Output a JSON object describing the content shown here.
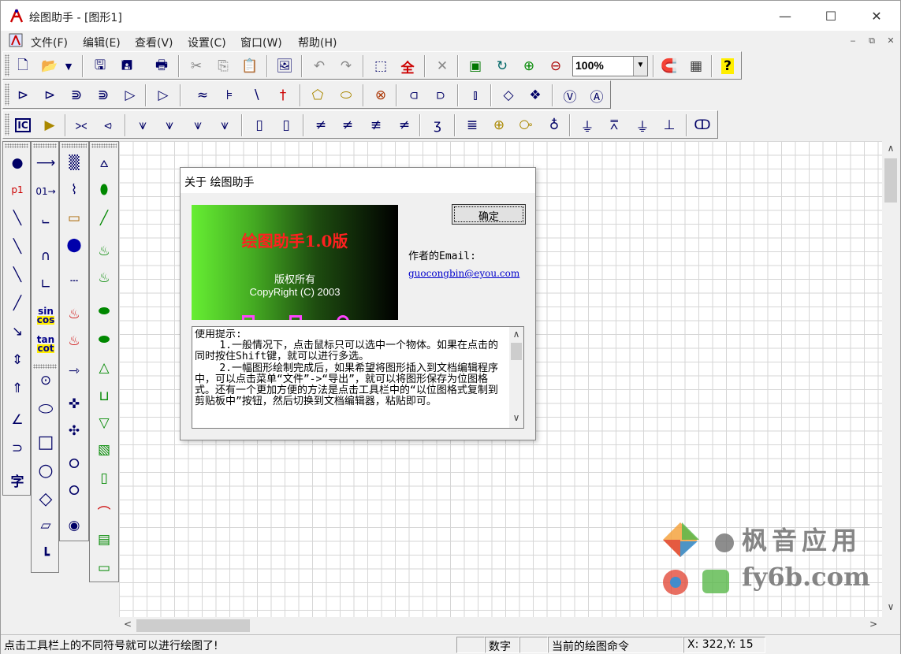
{
  "window": {
    "title": "绘图助手 - [图形1]"
  },
  "menu": {
    "items": [
      {
        "label": "文件(F)"
      },
      {
        "label": "编辑(E)"
      },
      {
        "label": "查看(V)"
      },
      {
        "label": "设置(C)"
      },
      {
        "label": "窗口(W)"
      },
      {
        "label": "帮助(H)"
      }
    ]
  },
  "toolbar": {
    "zoom_value": "100%"
  },
  "palette": {
    "p1_label": "p1",
    "sin_label": "sin",
    "cos_label": "cos",
    "tan_label": "tan",
    "cot_label": "cot",
    "text_label": "字"
  },
  "dialog": {
    "title": "关于 绘图助手",
    "splash_title": "绘图助手1.0版",
    "splash_rights": "版权所有",
    "splash_copyright": "CopyRight (C) 2003",
    "ok_label": "确定",
    "email_label": "作者的Email:",
    "email": "guocongbin@eyou.com",
    "tips": "使用提示:\n    1.一般情况下，点击鼠标只可以选中一个物体。如果在点击的同时按住Shift键，就可以进行多选。\n    2.一幅图形绘制完成后，如果希望将图形插入到文档编辑程序中，可以点击菜单“文件”->“导出”，就可以将图形保存为位图格式。还有一个更加方便的方法是点击工具栏中的“以位图格式复制到剪贴板中”按钮，然后切换到文档编辑器，粘贴即可。"
  },
  "status": {
    "hint": "点击工具栏上的不同符号就可以进行绘图了!",
    "num_lock": "数字",
    "current_command": "当前的绘图命令",
    "coords": "X: 322,Y:  15"
  },
  "watermark": {
    "line1": "枫音应用",
    "line2": "fy6b.com"
  }
}
